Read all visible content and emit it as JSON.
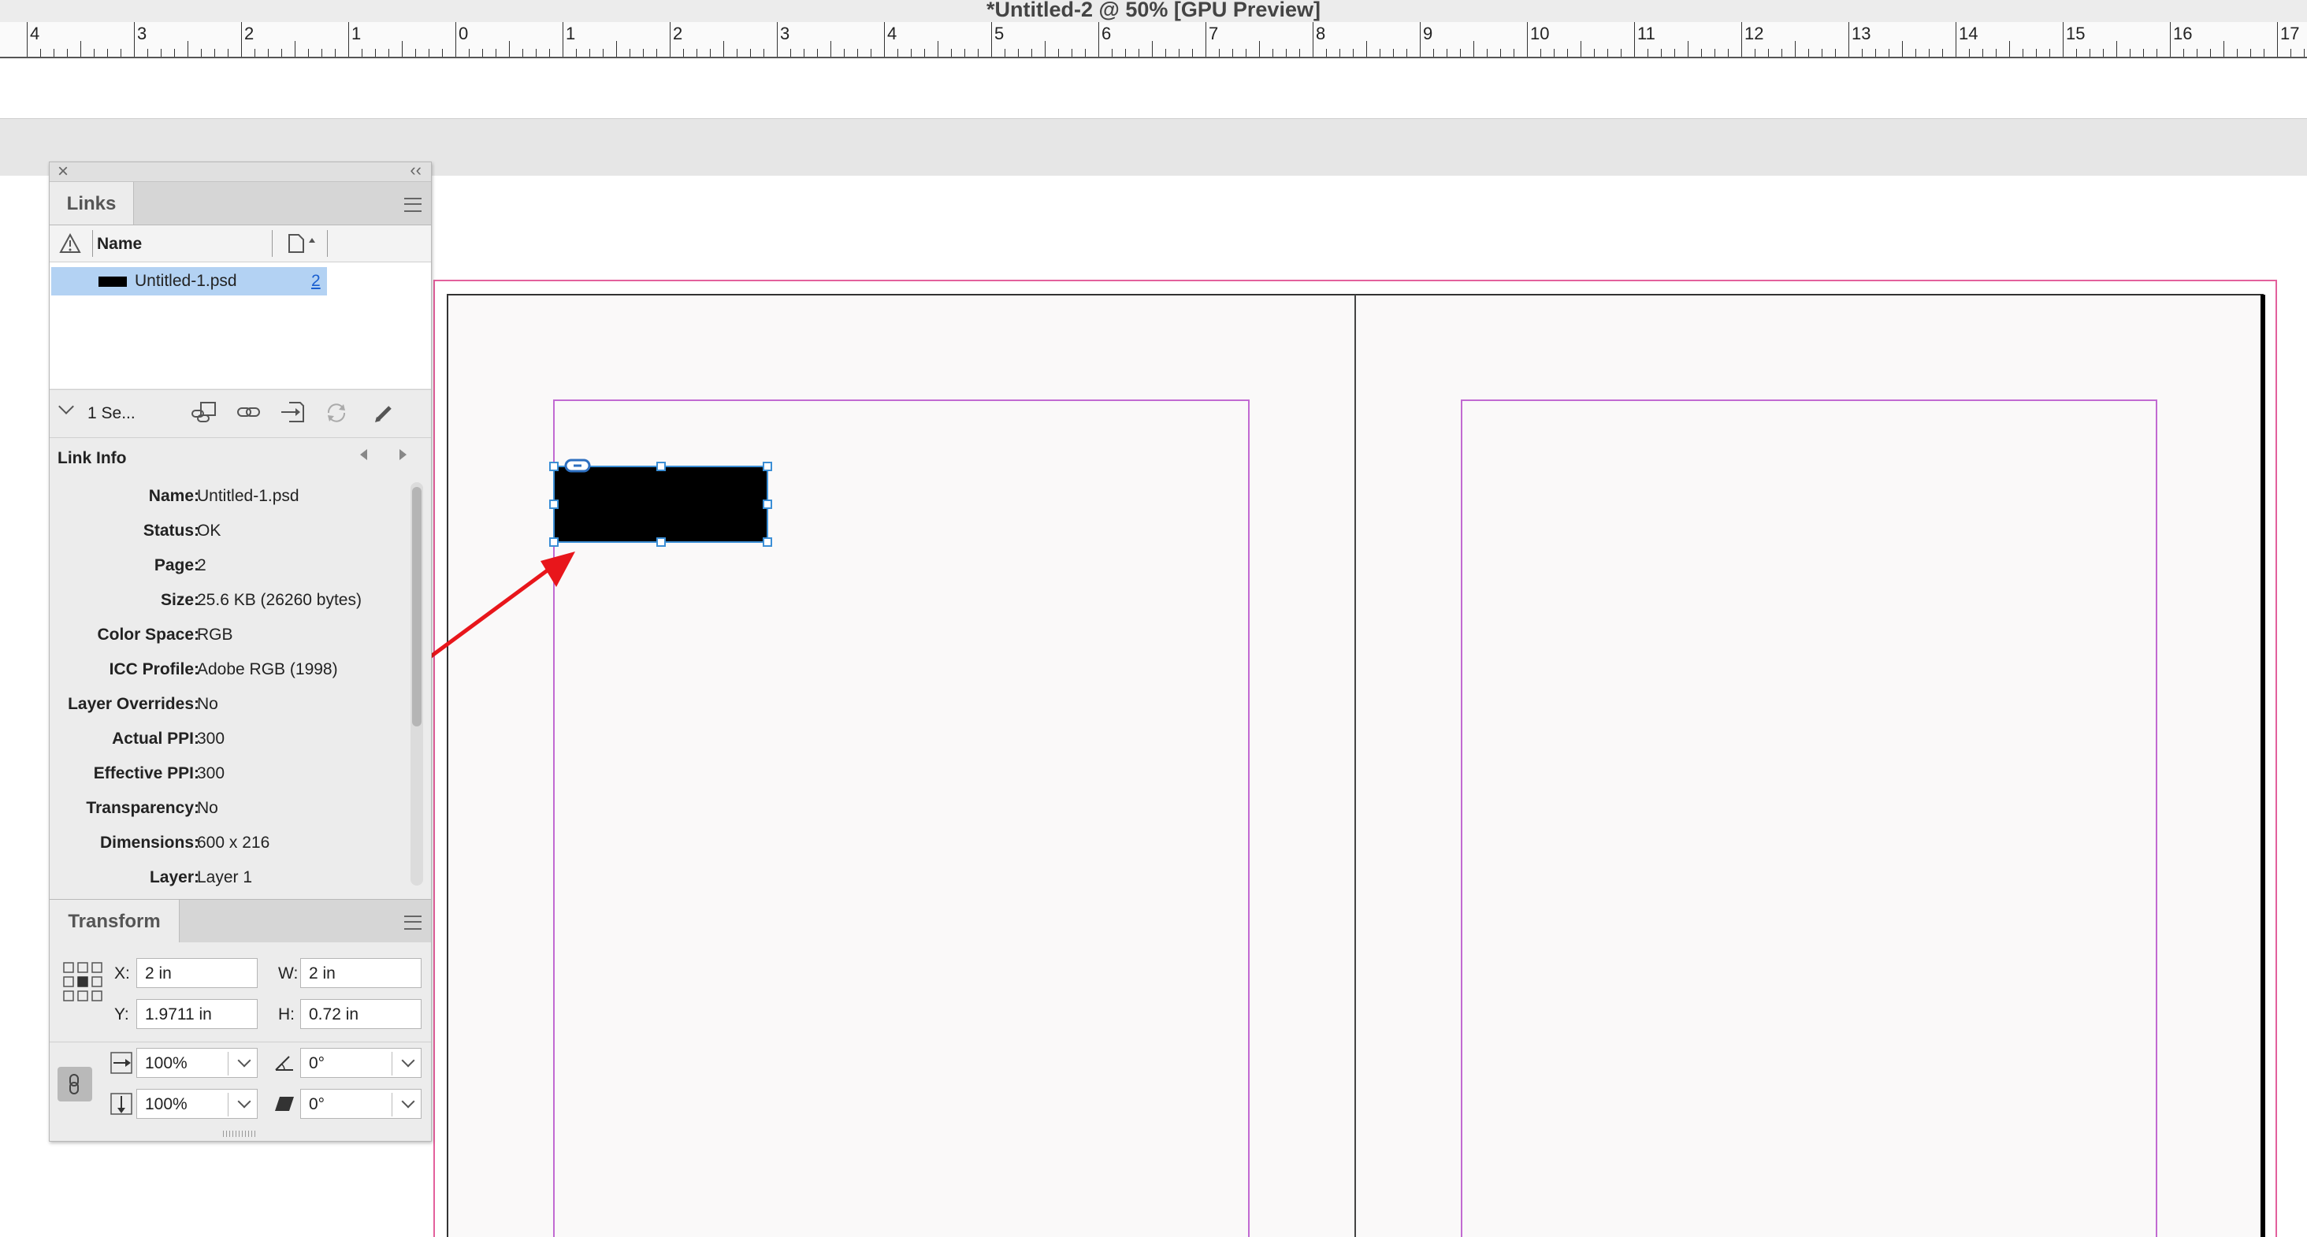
{
  "window": {
    "title": "*Untitled-2 @ 50% [GPU Preview]"
  },
  "ruler": {
    "labels": [
      "4",
      "3",
      "2",
      "1",
      "0",
      "1",
      "2",
      "3",
      "4",
      "5",
      "6",
      "7",
      "8",
      "9",
      "10",
      "11",
      "12",
      "13",
      "14",
      "15",
      "16",
      "17"
    ]
  },
  "links_panel": {
    "tab_label": "Links",
    "columns": {
      "name": "Name"
    },
    "items": [
      {
        "name": "Untitled-1.psd",
        "page": "2"
      }
    ],
    "selection_summary": "1 Se...",
    "link_info_title": "Link Info",
    "link_info": [
      {
        "key": "Name:",
        "value": "Untitled-1.psd"
      },
      {
        "key": "Status:",
        "value": "OK"
      },
      {
        "key": "Page:",
        "value": "2"
      },
      {
        "key": "Size:",
        "value": "25.6 KB (26260 bytes)"
      },
      {
        "key": "Color Space:",
        "value": "RGB"
      },
      {
        "key": "ICC Profile:",
        "value": "Adobe RGB (1998)"
      },
      {
        "key": "Layer Overrides:",
        "value": "No"
      },
      {
        "key": "Actual PPI:",
        "value": "300"
      },
      {
        "key": "Effective PPI:",
        "value": "300"
      },
      {
        "key": "Transparency:",
        "value": "No"
      },
      {
        "key": "Dimensions:",
        "value": "600 x 216"
      },
      {
        "key": "Layer:",
        "value": "Layer 1"
      }
    ]
  },
  "transform_panel": {
    "tab_label": "Transform",
    "x_label": "X:",
    "x_value": "2 in",
    "y_label": "Y:",
    "y_value": "1.9711 in",
    "w_label": "W:",
    "w_value": "2 in",
    "h_label": "H:",
    "h_value": "0.72 in",
    "scale_x": "100%",
    "scale_y": "100%",
    "rotation": "0°",
    "shear": "0°"
  },
  "colors": {
    "annotation_red": "#e8161b",
    "selection_blue": "#3c8fd6",
    "margin_magenta": "#c16ad2",
    "bleed_pink": "#e3609c",
    "page_fill": "#faf9f9",
    "row_highlight": "#b3d2f3"
  },
  "icons": [
    "close-icon",
    "collapse-icon",
    "warning-icon",
    "page-icon",
    "chevron-down-icon",
    "relink-icon",
    "goto-link-icon",
    "embed-icon",
    "update-link-icon",
    "edit-original-icon",
    "prev-arrow-icon",
    "next-arrow-icon",
    "reference-point-icon",
    "constrain-link-icon",
    "scale-x-icon",
    "scale-y-icon",
    "rotate-icon",
    "shear-icon",
    "link-badge-icon"
  ]
}
